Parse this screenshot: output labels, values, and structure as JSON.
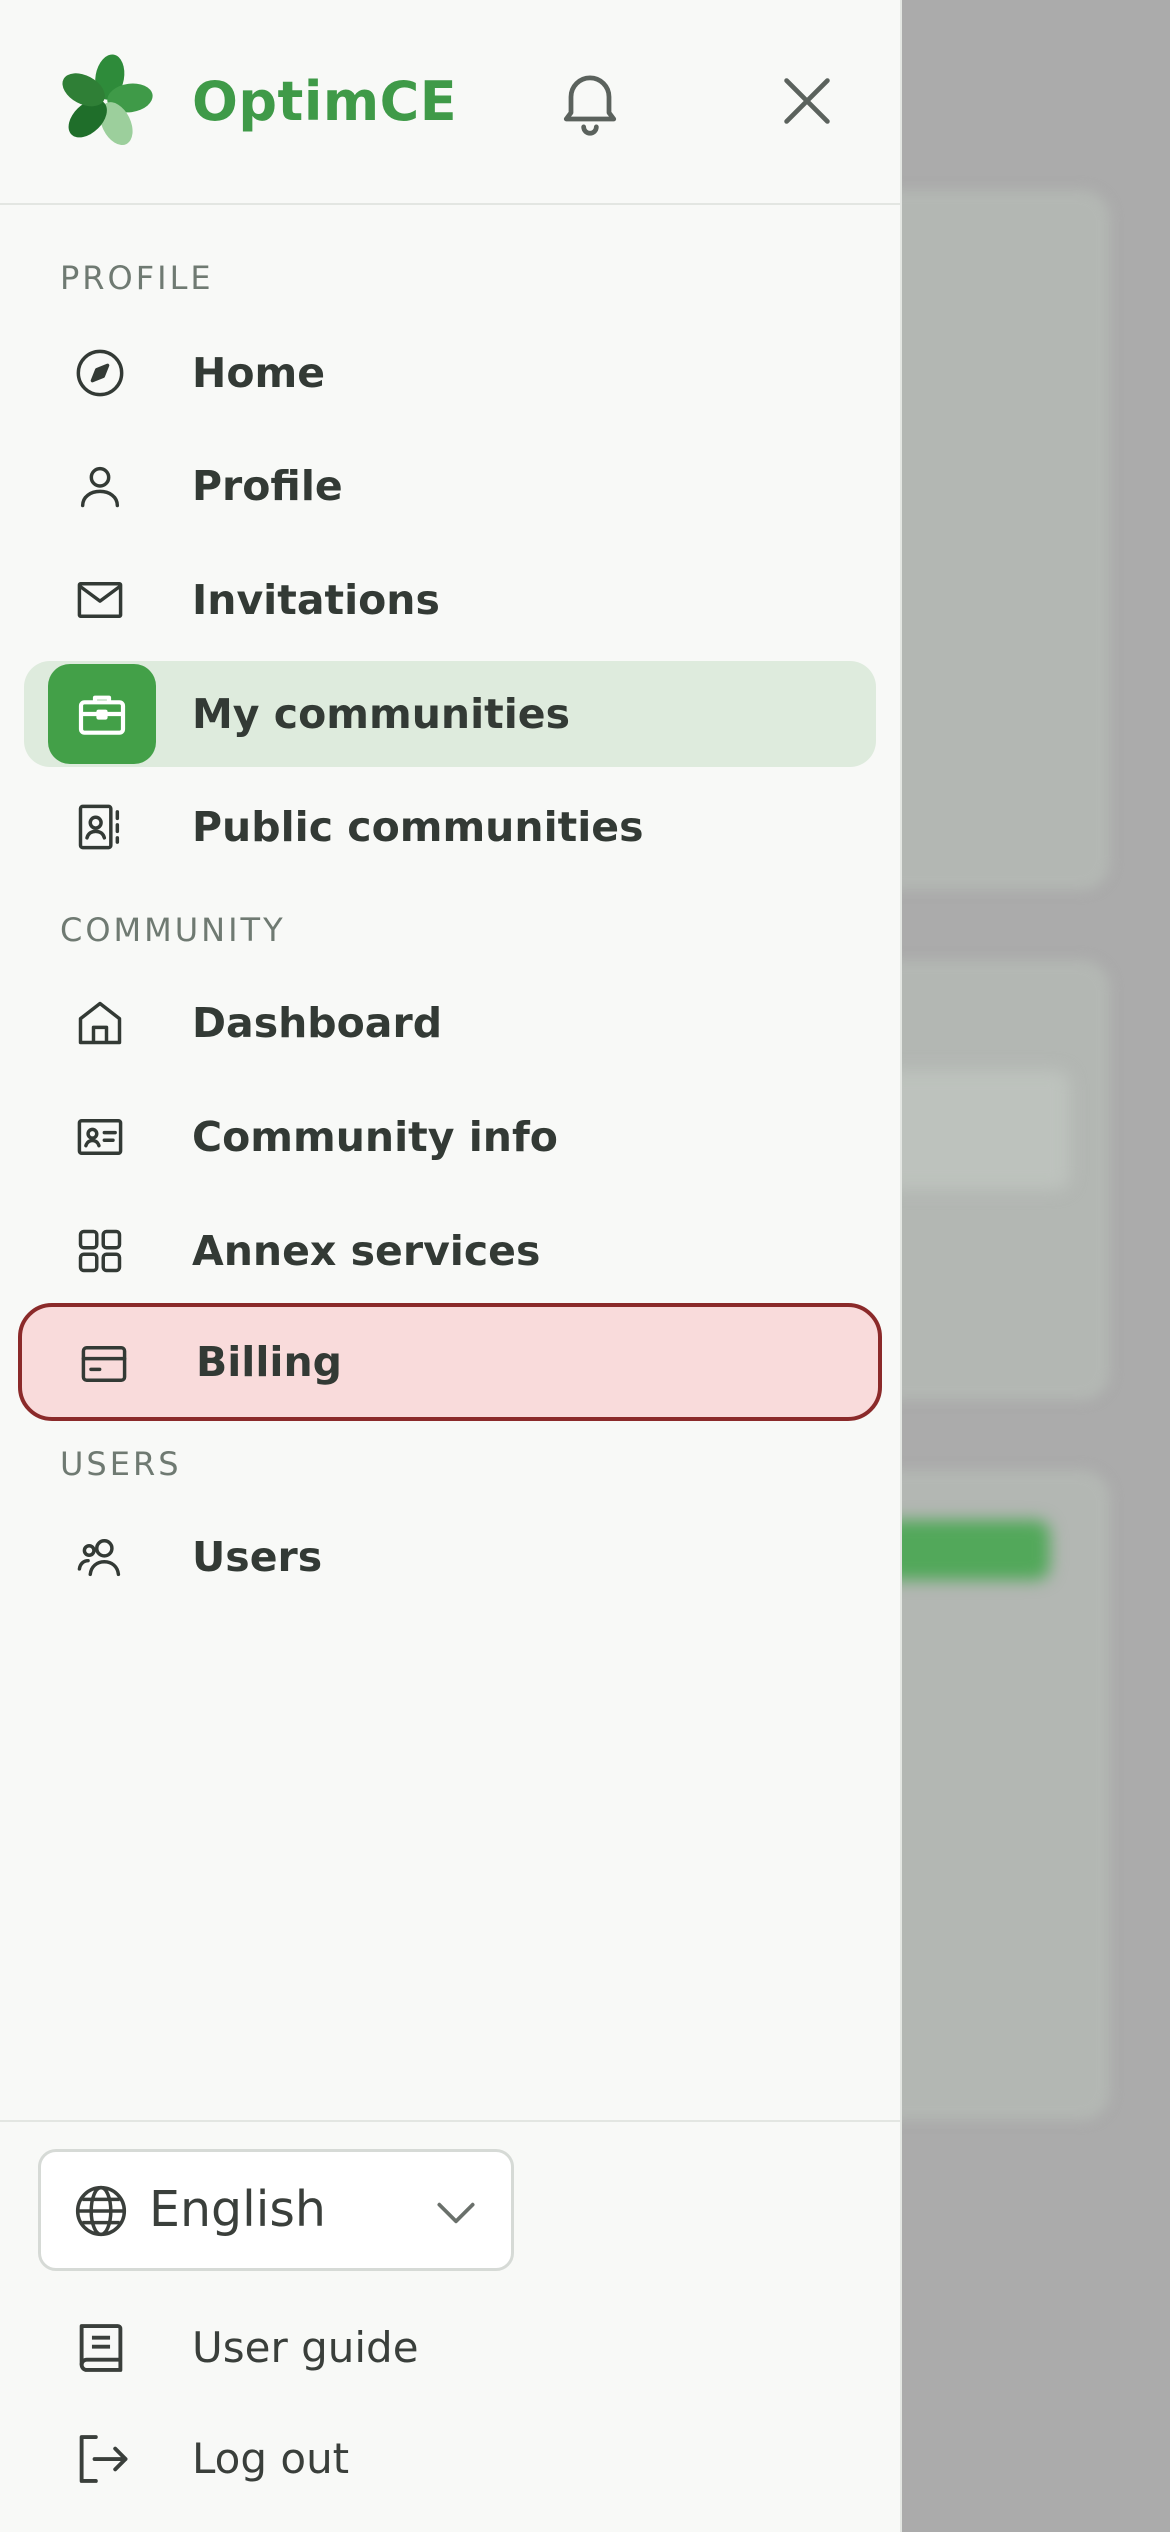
{
  "app": {
    "brand": "OptimCE"
  },
  "colors": {
    "brand_green": "#3f9a48",
    "active_bg": "#deebdd",
    "highlight_bg": "#f9dbdb",
    "highlight_border": "#8b2a2a"
  },
  "sections": {
    "profile": "PROFILE",
    "community": "COMMUNITY",
    "users": "USERS"
  },
  "nav": {
    "home": "Home",
    "profile": "Profile",
    "invitations": "Invitations",
    "my_communities": "My communities",
    "public_communities": "Public communities",
    "dashboard": "Dashboard",
    "community_info": "Community info",
    "annex_services": "Annex services",
    "billing": "Billing",
    "users": "Users"
  },
  "active_item": "My communities",
  "highlighted_item": "Billing",
  "footer": {
    "language": "English",
    "user_guide": "User guide",
    "logout": "Log out"
  },
  "icons": {
    "home": "compass-icon",
    "profile": "user-icon",
    "invitations": "mail-icon",
    "my_communities": "briefcase-icon",
    "public_communities": "contact-book-icon",
    "dashboard": "house-icon",
    "community_info": "id-card-icon",
    "annex_services": "grid-icon",
    "billing": "credit-card-icon",
    "users": "users-icon"
  }
}
